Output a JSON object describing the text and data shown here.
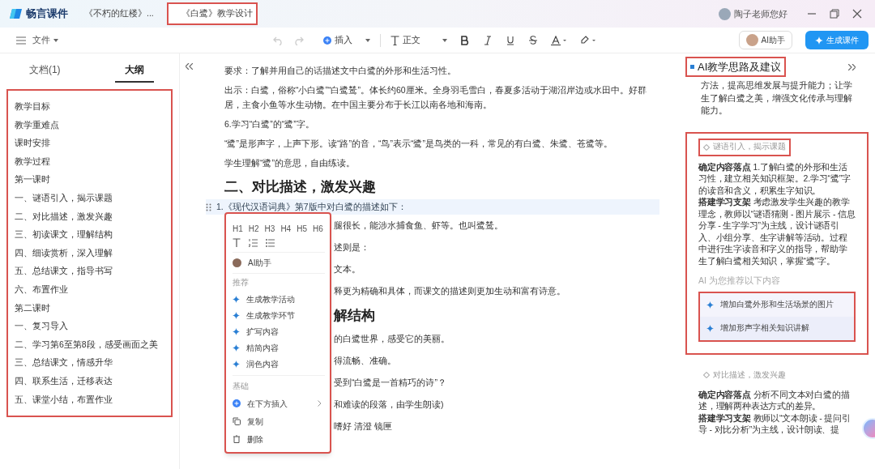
{
  "app": {
    "name": "畅言课件"
  },
  "tabs": [
    {
      "title": "《不朽的红楼》...",
      "selected": false,
      "highlighted": false
    },
    {
      "title": "《白鹭》教学设计",
      "selected": true,
      "highlighted": true
    }
  ],
  "user": {
    "greeting": "陶子老师您好"
  },
  "toolbar": {
    "file_menu": "文件",
    "insert": "插入",
    "style": "正文",
    "ai_button": "AI助手",
    "generate_button": "生成课件"
  },
  "left_panel": {
    "tabs": [
      {
        "label": "文档(1)",
        "selected": false
      },
      {
        "label": "大纲",
        "selected": true
      }
    ],
    "highlighted": true,
    "outline": [
      "教学目标",
      "教学重难点",
      "课时安排",
      "教学过程",
      "第一课时",
      "一、谜语引入，揭示课题",
      "二、对比描述，激发兴趣",
      "三、初读课文，理解结构",
      "四、细读赏析，深入理解",
      "五、总结课文，指导书写",
      "六、布置作业",
      "第二课时",
      "一、复习导入",
      "二、学习第6至第8段，感受画面之美",
      "三、总结课文，情感升华",
      "四、联系生活，迁移表达",
      "五、课堂小结，布置作业"
    ]
  },
  "document": [
    {
      "kind": "para",
      "text": "要求：了解并用自己的话描述文中白鹭的外形和生活习性。"
    },
    {
      "kind": "para",
      "text": "出示：白鹭，俗称“小白鹭”“白鹭鸶”。体长约60厘米。全身羽毛雪白，春夏多活动于湖沼岸边或水田中。好群居，主食小鱼等水生动物。在中国主要分布于长江以南各地和海南。"
    },
    {
      "kind": "para",
      "text": "6.学习“白鹭”的“鹭”字。"
    },
    {
      "kind": "para",
      "text": "“鹭”是形声字，上声下形。读“路”的音，“鸟”表示“鹭”是鸟类的一科，常见的有白鹭、朱鹭、苍鹭等。"
    },
    {
      "kind": "para",
      "text": "学生理解“鹭”的意思，自由练读。"
    },
    {
      "kind": "heading",
      "text": "二、对比描述，激发兴趣"
    },
    {
      "kind": "current",
      "text": "1.《现代汉语词典》第7版中对白鹭的描述如下："
    },
    {
      "kind": "partial",
      "text": "腿很长，能涉水捕食鱼、虾等。也叫鹭鸶。"
    },
    {
      "kind": "partial",
      "text": "述则是："
    },
    {
      "kind": "partial",
      "text": "文本。"
    },
    {
      "kind": "partial",
      "text": "释更为精确和具体，而课文的描述则更加生动和富有诗意。"
    },
    {
      "kind": "partial_heading",
      "text": "解结构"
    },
    {
      "kind": "partial",
      "text": "的白鹭世界，感受它的美丽。"
    },
    {
      "kind": "partial",
      "text": "得流畅、准确。"
    },
    {
      "kind": "partial",
      "text": "受到“白鹭是一首精巧的诗”？"
    },
    {
      "kind": "partial",
      "text": "和难读的段落，由学生朗读)"
    },
    {
      "kind": "partial",
      "text": "嗜好 清澄 镜匣"
    }
  ],
  "block_menu": {
    "highlighted": true,
    "headings": [
      "H1",
      "H2",
      "H3",
      "H4",
      "H5",
      "H6"
    ],
    "ai_item": "AI助手",
    "recommend_label": "推荐",
    "recommend_items": [
      "生成教学活动",
      "生成教学环节",
      "扩写内容",
      "精简内容",
      "润色内容"
    ],
    "basic_label": "基础",
    "basic_items": [
      {
        "kind": "insert",
        "label": "在下方插入"
      },
      {
        "kind": "copy",
        "label": "复制"
      },
      {
        "kind": "delete",
        "label": "删除"
      }
    ]
  },
  "ai_panel": {
    "title": "AI教学思路及建议",
    "title_highlighted": true,
    "intro": "方法，提高思维发展与提升能力；让学生了解白鹭之美，增强文化传承与理解能力。",
    "cards": [
      {
        "tag": "谜语引入，揭示课题",
        "highlighted": true,
        "paragraphs": [
          "**确定内容落点** 1.了解白鹭的外形和生活习性，建立相关知识框架。2.学习“鹭”字的读音和含义，积累生字知识。",
          "**搭建学习支架** 考虑激发学生兴趣的教学理念，教师以“谜语猜测 - 图片展示 - 信息分享 - 生字学习”为主线，设计谜语引入、小组分享、生字讲解等活动。过程中进行生字读音和字义的指导，帮助学生了解白鹭相关知识，掌握“鹭”字。"
        ],
        "suggest_label": "AI 为您推荐以下内容",
        "suggestions": [
          "增加白鹭外形和生活场景的图片",
          "增加形声字相关知识讲解"
        ]
      },
      {
        "tag": "对比描述，激发兴趣",
        "highlighted": false,
        "paragraphs": [
          "**确定内容落点** 分析不同文本对白鹭的描述，理解两种表达方式的差异。",
          "**搭建学习支架** 教师以“文本朗读 - 提问引导 - 对比分析”为主线，设计朗读、提"
        ]
      }
    ]
  }
}
